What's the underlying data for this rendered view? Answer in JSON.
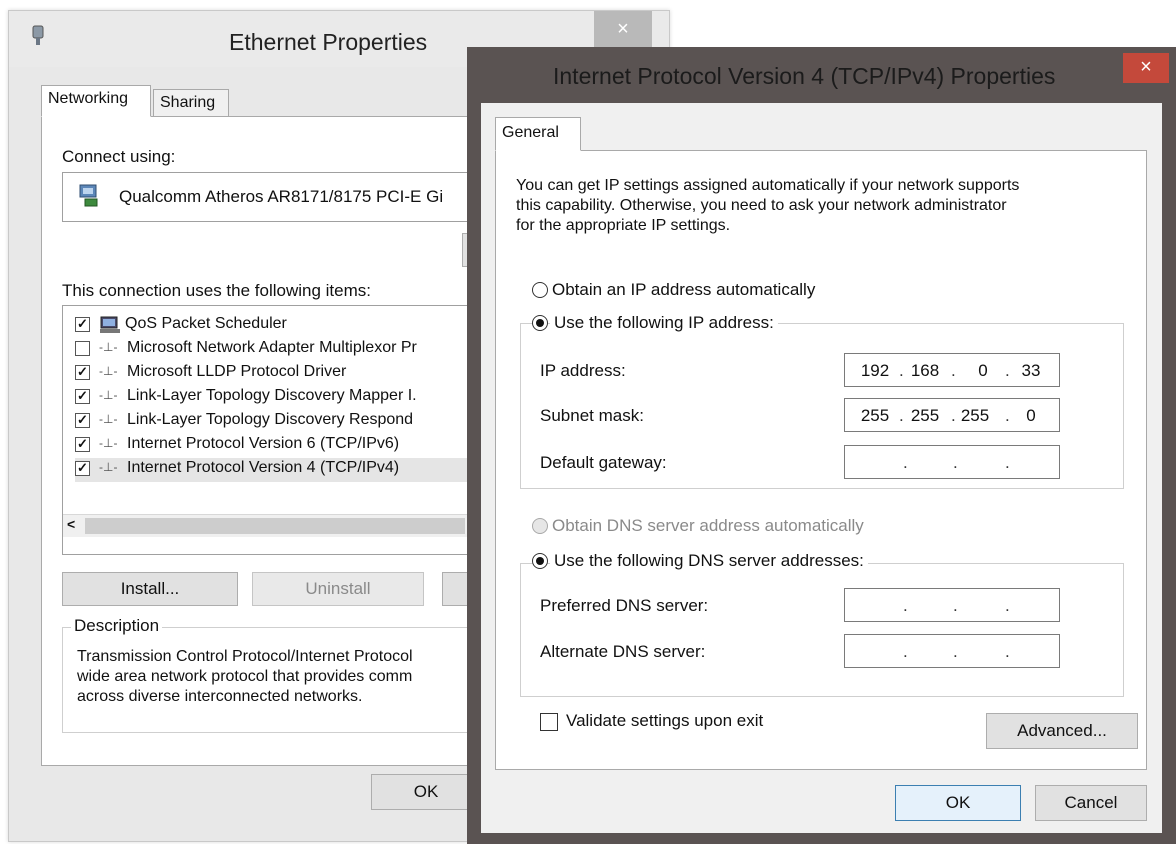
{
  "ethernet": {
    "title": "Ethernet Properties",
    "close_glyph": "×",
    "tabs": [
      "Networking",
      "Sharing"
    ],
    "connect_using_label": "Connect using:",
    "adapter_name": "Qualcomm Atheros AR8171/8175 PCI-E Gi",
    "items_label": "This connection uses the following items:",
    "items": [
      {
        "label": "QoS Packet Scheduler",
        "checked": true,
        "icon": "network-service-icon"
      },
      {
        "label": "Microsoft Network Adapter Multiplexor Pr",
        "checked": false,
        "icon": "protocol-icon"
      },
      {
        "label": "Microsoft LLDP Protocol Driver",
        "checked": true,
        "icon": "protocol-icon"
      },
      {
        "label": "Link-Layer Topology Discovery Mapper I.",
        "checked": true,
        "icon": "protocol-icon"
      },
      {
        "label": "Link-Layer Topology Discovery Respond",
        "checked": true,
        "icon": "protocol-icon"
      },
      {
        "label": "Internet Protocol Version 6 (TCP/IPv6)",
        "checked": true,
        "icon": "protocol-icon"
      },
      {
        "label": "Internet Protocol Version 4 (TCP/IPv4)",
        "checked": true,
        "icon": "protocol-icon"
      }
    ],
    "scroll_left_glyph": "<",
    "install_label": "Install...",
    "uninstall_label": "Uninstall",
    "description_legend": "Description",
    "description_lines": [
      "Transmission Control Protocol/Internet Protocol",
      "wide area network protocol that provides comm",
      "across diverse interconnected networks."
    ],
    "ok_label": "OK"
  },
  "ipv4": {
    "title": "Internet Protocol Version 4 (TCP/IPv4) Properties",
    "close_glyph": "×",
    "tab_general": "General",
    "intro_lines": [
      "You can get IP settings assigned automatically if your network supports",
      "this capability. Otherwise, you need to ask your network administrator",
      "for the appropriate IP settings."
    ],
    "obtain_ip_auto": "Obtain an IP address automatically",
    "use_following_ip": "Use the following IP address:",
    "ip_address_label": "IP address:",
    "ip_address": [
      "192",
      "168",
      "0",
      "33"
    ],
    "subnet_mask_label": "Subnet mask:",
    "subnet_mask": [
      "255",
      "255",
      "255",
      "0"
    ],
    "default_gateway_label": "Default gateway:",
    "default_gateway": [
      "",
      "",
      "",
      ""
    ],
    "obtain_dns_auto": "Obtain DNS server address automatically",
    "use_following_dns": "Use the following DNS server addresses:",
    "preferred_dns_label": "Preferred DNS server:",
    "preferred_dns": [
      "",
      "",
      "",
      ""
    ],
    "alternate_dns_label": "Alternate DNS server:",
    "alternate_dns": [
      "",
      "",
      "",
      ""
    ],
    "validate_label": "Validate settings upon exit",
    "advanced_label": "Advanced...",
    "ok_label": "OK",
    "cancel_label": "Cancel",
    "dot": "."
  },
  "colors": {
    "ipv4_frame": "#5a5352",
    "ipv4_close": "#c4493b",
    "eth_close": "#b9b9b9",
    "selection": "#e5e5e5"
  }
}
